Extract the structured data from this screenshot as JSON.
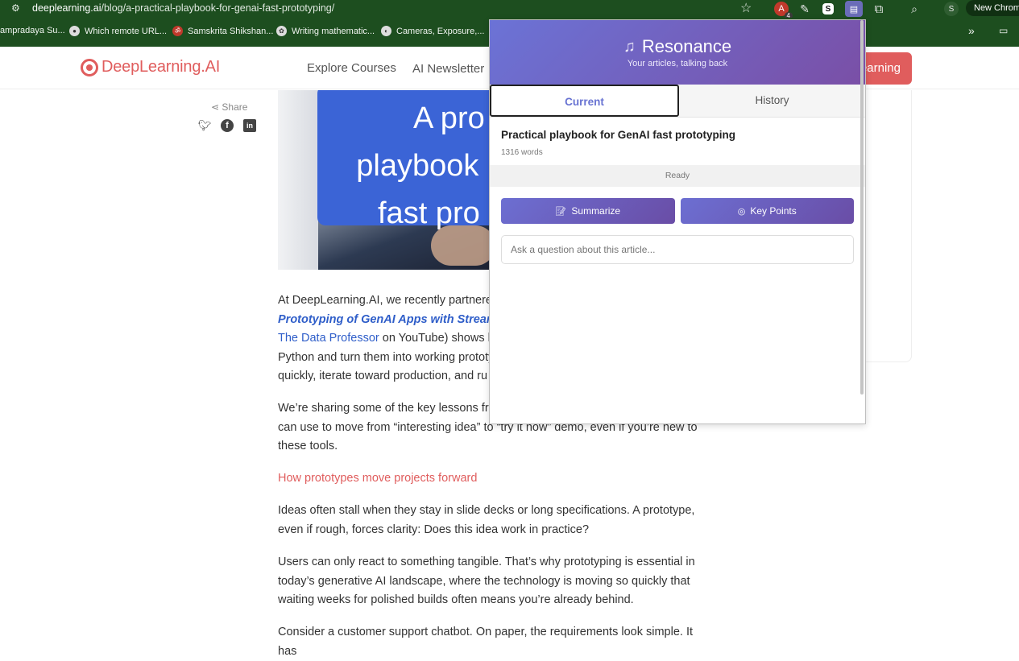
{
  "browser": {
    "url_host": "deeplearning.ai",
    "url_path": "/blog/a-practical-playbook-for-genai-fast-prototyping/",
    "ext_badge": "4",
    "ext_s_label": "S",
    "profile_initial": "S",
    "new_chrome_label": "New Chrome",
    "bookmarks": [
      {
        "label": "ampradaya Su...",
        "icon": ""
      },
      {
        "label": "Which remote URL...",
        "icon": "github-icon"
      },
      {
        "label": "Samskrita Shikshan...",
        "icon": "bookmark-icon"
      },
      {
        "label": "Writing mathematic...",
        "icon": "bookmark-icon"
      },
      {
        "label": "Cameras, Exposure,...",
        "icon": "bookmark-icon"
      }
    ]
  },
  "site": {
    "logo_text": "DeepLearning.AI",
    "nav": [
      "Explore Courses",
      "AI Newsletter"
    ],
    "cta_label": "earning"
  },
  "article": {
    "share_label": "Share",
    "hero_title": "A pro\nplaybook\nfast pro",
    "p1_text": "At DeepLearning.AI, we recently partnere",
    "p1_link1": "Prototyping of GenAI Apps with Streamli",
    "p1_link2": "The Data Professor",
    "p1_after_link2": " on YouTube) shows h",
    "p1_line4": "Python and turn them into working prototy",
    "p1_line5": "quickly, iterate toward production, and ru",
    "p2_line1": "We’re sharing some of the key lessons fro",
    "p2_line2": "can use to move from “interesting idea” to “try it now” demo, even if you’re new to",
    "p2_line3": "these tools.",
    "heading": "How prototypes move projects forward",
    "p3": "Ideas often stall when they stay in slide decks or long specifications. A prototype, even if rough, forces clarity: Does this idea work in practice?",
    "p4": "Users can only react to something tangible. That’s why prototyping is essential in today’s generative AI landscape, where the technology is moving so quickly that waiting weeks for polished builds often means you’re already behind.",
    "p5": "Consider a customer support chatbot. On paper, the requirements look simple. It has"
  },
  "popup": {
    "title": "Resonance",
    "subtitle": "Your articles, talking back",
    "tabs": [
      "Current",
      "History"
    ],
    "article_title": "Practical playbook for GenAI fast prototyping",
    "word_count": "1316 words",
    "status": "Ready",
    "summarize_label": "Summarize",
    "key_points_label": "Key Points",
    "ask_placeholder": "Ask a question about this article...",
    "colors": {
      "header_start": "#6b73d6",
      "header_end": "#7a4fa6",
      "active_tab": "#6873d2"
    }
  }
}
